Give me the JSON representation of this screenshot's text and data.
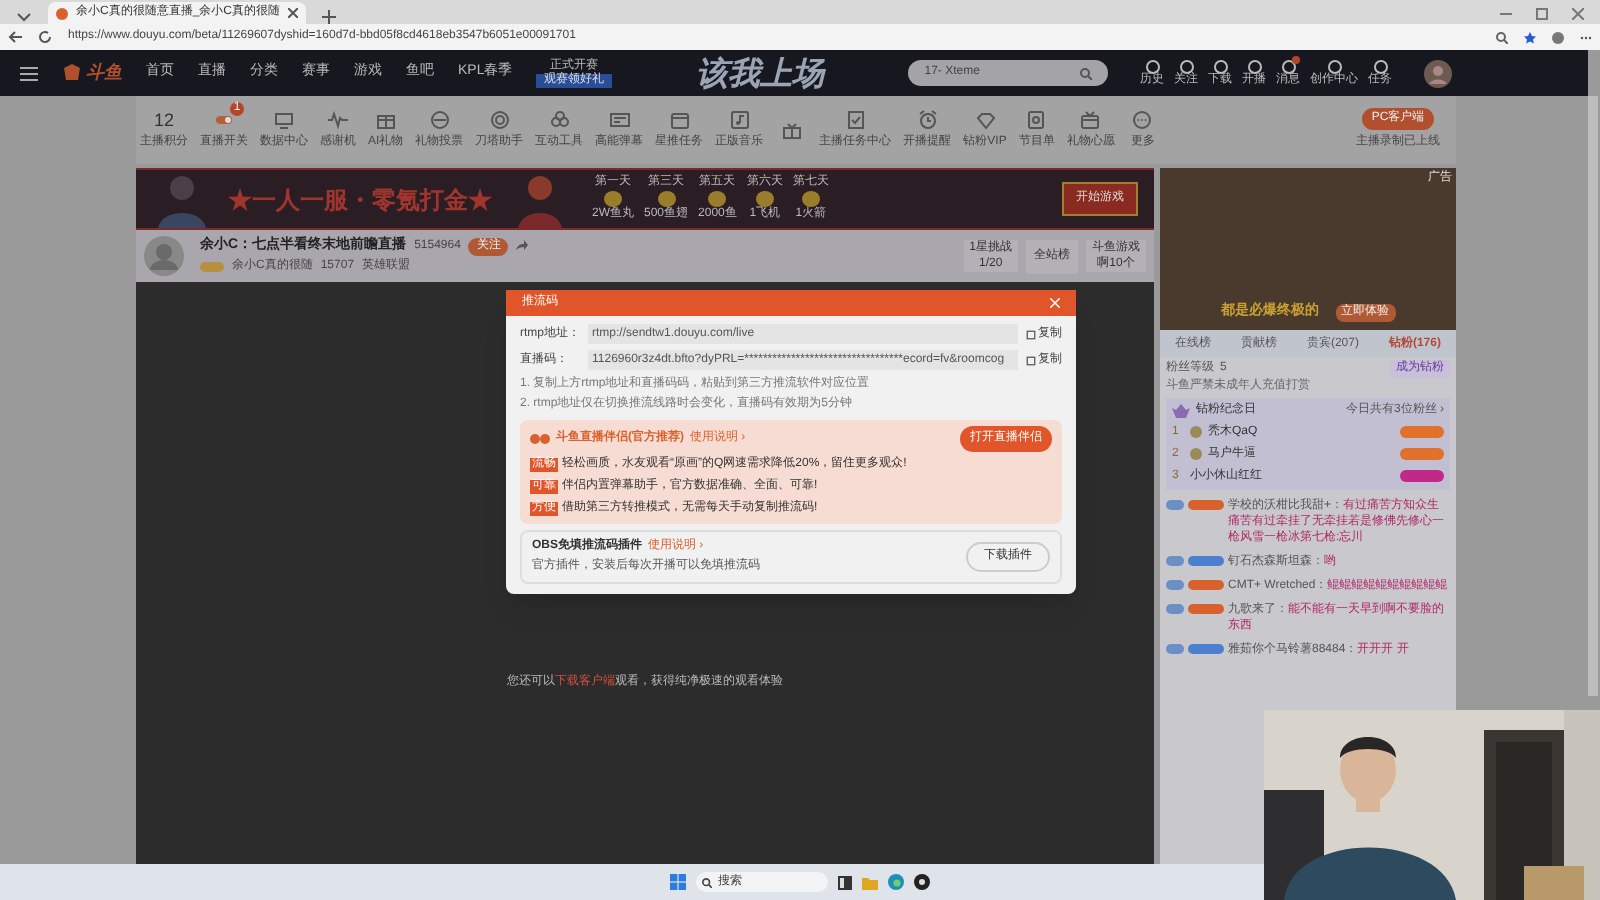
{
  "browser": {
    "tab_title": "余小C真的很随意直播_余小C真的很随",
    "url": "https://www.douyu.com/beta/11269607dyshid=160d7d-bbd05f8cd4618eb3547b6051e00091701"
  },
  "nav": {
    "logo": "斗鱼",
    "links": [
      "首页",
      "直播",
      "分类",
      "赛事",
      "游戏",
      "鱼吧",
      "KPL春季"
    ],
    "promo_title": "正式开赛",
    "promo_button": "观赛领好礼",
    "banner": "该我上场",
    "search_placeholder": "17- Xteme",
    "actions": [
      "历史",
      "关注",
      "下载",
      "开播",
      "消息",
      "创作中心",
      "任务"
    ]
  },
  "toolbar": {
    "score": "12",
    "score_label": "主播积分",
    "items": [
      {
        "kind": "labeled",
        "label": "直播开关",
        "badge": "1"
      },
      {
        "label": "数据中心"
      },
      {
        "label": "感谢机"
      },
      {
        "label": "AI礼物"
      },
      {
        "label": "礼物投票"
      },
      {
        "label": "刀塔助手"
      },
      {
        "label": "互动工具"
      },
      {
        "label": "高能弹幕"
      },
      {
        "label": "星推任务"
      },
      {
        "label": "正版音乐"
      },
      {
        "kind": "icon_only"
      },
      {
        "label": "主播任务中心"
      },
      {
        "label": "开播提醒"
      },
      {
        "label": "钻粉VIP"
      },
      {
        "label": "节目单"
      },
      {
        "label": "礼物心愿"
      },
      {
        "label": "更多"
      }
    ],
    "client_button": "PC客户端",
    "client_note": "主播录制已上线"
  },
  "ad": {
    "slogan": "★一人一服・零氪打金★",
    "rewards": [
      {
        "day": "第一天",
        "prize": "2W鱼丸"
      },
      {
        "day": "第三天",
        "prize": "500鱼翅"
      },
      {
        "day": "第五天",
        "prize": "2000鱼"
      },
      {
        "day": "第六天",
        "prize": "1飞机"
      },
      {
        "day": "第七天",
        "prize": "1火箭"
      }
    ],
    "button": "开始游戏",
    "side_tag": "广告",
    "side_caption": "都是必爆终极的",
    "side_button": "立即体验"
  },
  "streamer": {
    "title": "余小C：七点半看终末地前瞻直播",
    "count": "5154964",
    "follow": "关注",
    "room": "余小C真的很随",
    "fans": "15707",
    "category": "英雄联盟",
    "challenge": "1星挑战",
    "challenge_progress": "1/20",
    "rank": "全站榜",
    "game": "斗鱼游戏",
    "game_note": "啊10个"
  },
  "video": {
    "notice_before": "您还可以",
    "notice_link": "下载客户端",
    "notice_after": "观看，获得纯净极速的观看体验"
  },
  "dialog": {
    "title": "推流码",
    "fields": [
      {
        "label": "rtmp地址：",
        "value": "rtmp://sendtw1.douyu.com/live",
        "copy": "复制"
      },
      {
        "label": "直播码：",
        "value": "1126960r3z4dt.bfto?dyPRL=**********************************ecord=fv&roomcog",
        "copy": "复制"
      }
    ],
    "notes": [
      "1. 复制上方rtmp地址和直播码码，粘贴到第三方推流软件对应位置",
      "2. rtmp地址仅在切换推流线路时会变化，直播码有效期为5分钟"
    ],
    "companion": {
      "title": "斗鱼直播伴侣(官方推荐)",
      "help": "使用说明 ›",
      "button": "打开直播伴侣",
      "points": [
        {
          "tag": "流畅",
          "text": "轻松画质，水友观看“原画”的Q网速需求降低20%，留住更多观众!"
        },
        {
          "tag": "可靠",
          "text": "伴侣内置弹幕助手，官方数据准确、全面、可靠!"
        },
        {
          "tag": "方便",
          "text": "借助第三方转推模式，无需每天手动复制推流码!"
        }
      ]
    },
    "obs": {
      "title": "OBS免填推流码插件",
      "help": "使用说明 ›",
      "description": "官方插件，安装后每次开播可以免填推流码",
      "button": "下载插件"
    }
  },
  "chat": {
    "tabs": [
      {
        "label": "在线榜",
        "selected": false
      },
      {
        "label": "贡献榜",
        "selected": false
      },
      {
        "label": "贵宾(207)",
        "selected": false
      },
      {
        "label": "钻粉(176)",
        "selected": true
      }
    ],
    "fan_level": "粉丝等级",
    "fan_level_value": "5",
    "warning": "斗鱼严禁未成年人充值打赏",
    "join": "成为钻粉",
    "anniversary": "钻粉纪念日",
    "anniversary_note": "今日共有3位粉丝 ›",
    "ranks": [
      {
        "rank": "1",
        "name": "秃木QaQ",
        "color": "#e0702a"
      },
      {
        "rank": "2",
        "name": "马户牛逼",
        "color": "#e0702a"
      },
      {
        "rank": "3",
        "name": "小小休山红红",
        "color": "#c0288a"
      }
    ],
    "messages": [
      {
        "color": "#d9612e",
        "user": "学校的沃柑比我甜+：",
        "text": "有过痛苦方知众生痛苦有过牵挂了无牵挂若是修佛先修心一枪风雪一枪冰第七枪:忘川"
      },
      {
        "color": "#4d7fd0",
        "user": "钉石杰森斯坦森：",
        "text": "哟"
      },
      {
        "color": "#d9612e",
        "user": "CMT+ Wretched：",
        "text": "鲲鲲鲲鲲鲲鲲鲲鲲鲲鲲"
      },
      {
        "color": "#d9612e",
        "user": "九歌来了：",
        "text": "能不能有一天早到啊不要脸的东西"
      },
      {
        "color": "#4d7fd0",
        "user": "雅茹你个马铃薯88484：",
        "text": "开开开 开"
      }
    ]
  },
  "taskbar": {
    "search_placeholder": "搜索"
  }
}
